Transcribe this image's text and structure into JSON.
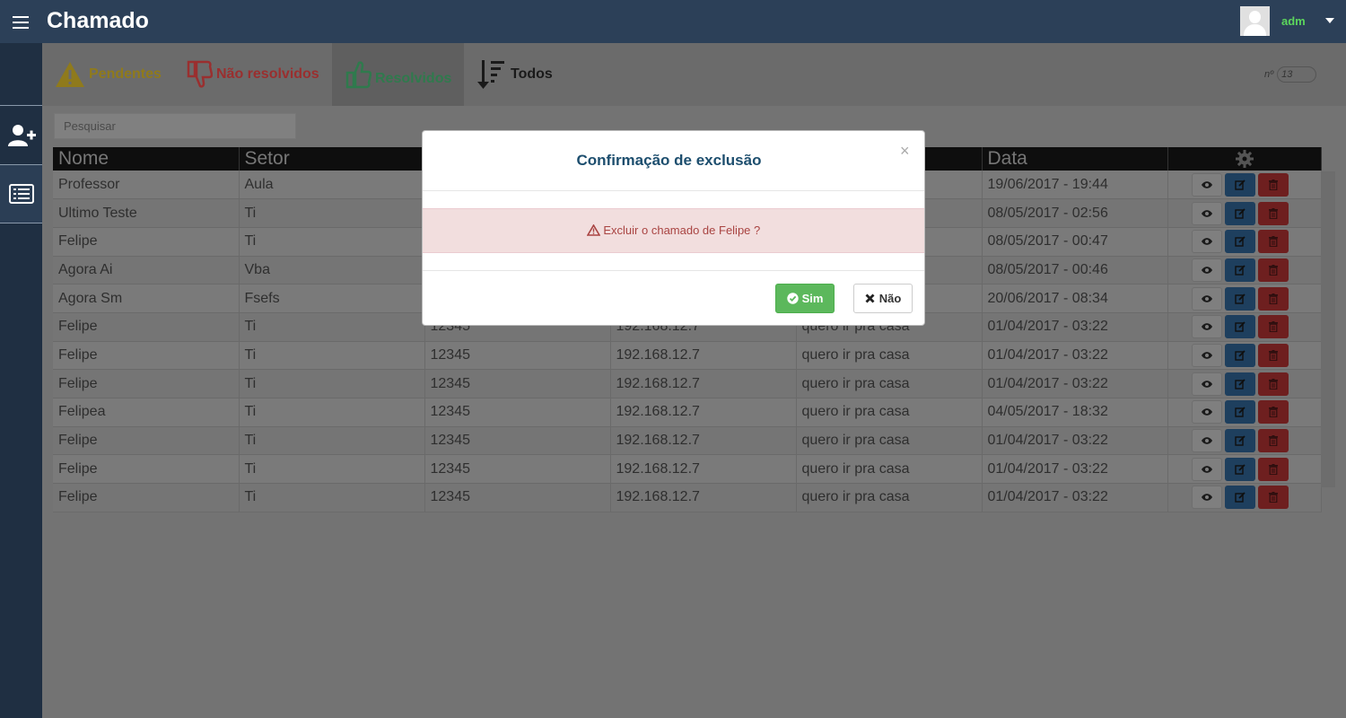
{
  "header": {
    "title": "Chamado",
    "username": "adm"
  },
  "sidebar": {
    "items": [
      {
        "icon": "user-plus-icon"
      },
      {
        "icon": "list-icon"
      }
    ]
  },
  "tabs": [
    {
      "label": "Pendentes",
      "icon": "warning-icon",
      "color": "#8f7a1c"
    },
    {
      "label": "Não resolvidos",
      "icon": "thumbs-down-icon",
      "color": "#9a2f2f"
    },
    {
      "label": "Resolvidos",
      "icon": "thumbs-up-icon",
      "color": "#2f7a4d",
      "active": true
    },
    {
      "label": "Todos",
      "icon": "sort-desc-icon",
      "color": "#1a1a1a"
    }
  ],
  "counter": {
    "prefix": "nº",
    "value": "13"
  },
  "search": {
    "placeholder": "Pesquisar"
  },
  "table": {
    "headers": [
      "Nome",
      "Setor",
      "",
      "",
      "",
      "Data"
    ],
    "rows": [
      [
        "Professor",
        "Aula",
        "",
        "",
        "",
        "19/06/2017 - 19:44"
      ],
      [
        "Ultimo Teste",
        "Ti",
        "",
        "",
        "",
        "08/05/2017 - 02:56"
      ],
      [
        "Felipe",
        "Ti",
        "",
        "",
        "",
        "08/05/2017 - 00:47"
      ],
      [
        "Agora Ai",
        "Vba",
        "",
        "",
        "",
        "08/05/2017 - 00:46"
      ],
      [
        "Agora Sm",
        "Fsefs",
        "",
        "",
        "",
        "20/06/2017 - 08:34"
      ],
      [
        "Felipe",
        "Ti",
        "12345",
        "192.168.12.7",
        "quero ir pra casa",
        "01/04/2017 - 03:22"
      ],
      [
        "Felipe",
        "Ti",
        "12345",
        "192.168.12.7",
        "quero ir pra casa",
        "01/04/2017 - 03:22"
      ],
      [
        "Felipe",
        "Ti",
        "12345",
        "192.168.12.7",
        "quero ir pra casa",
        "01/04/2017 - 03:22"
      ],
      [
        "Felipea",
        "Ti",
        "12345",
        "192.168.12.7",
        "quero ir pra casa",
        "04/05/2017 - 18:32"
      ],
      [
        "Felipe",
        "Ti",
        "12345",
        "192.168.12.7",
        "quero ir pra casa",
        "01/04/2017 - 03:22"
      ],
      [
        "Felipe",
        "Ti",
        "12345",
        "192.168.12.7",
        "quero ir pra casa",
        "01/04/2017 - 03:22"
      ],
      [
        "Felipe",
        "Ti",
        "12345",
        "192.168.12.7",
        "quero ir pra casa",
        "01/04/2017 - 03:22"
      ]
    ]
  },
  "modal": {
    "title": "Confirmação de exclusão",
    "close": "×",
    "message": "Excluir o chamado de Felipe ?",
    "confirm_label": "Sim",
    "cancel_label": "Não"
  },
  "colors": {
    "topbar": "#2c4058",
    "sidebar": "#1f2f42",
    "success": "#5cb85c",
    "danger_text": "#a94442",
    "alert_bg": "#f2dede"
  }
}
